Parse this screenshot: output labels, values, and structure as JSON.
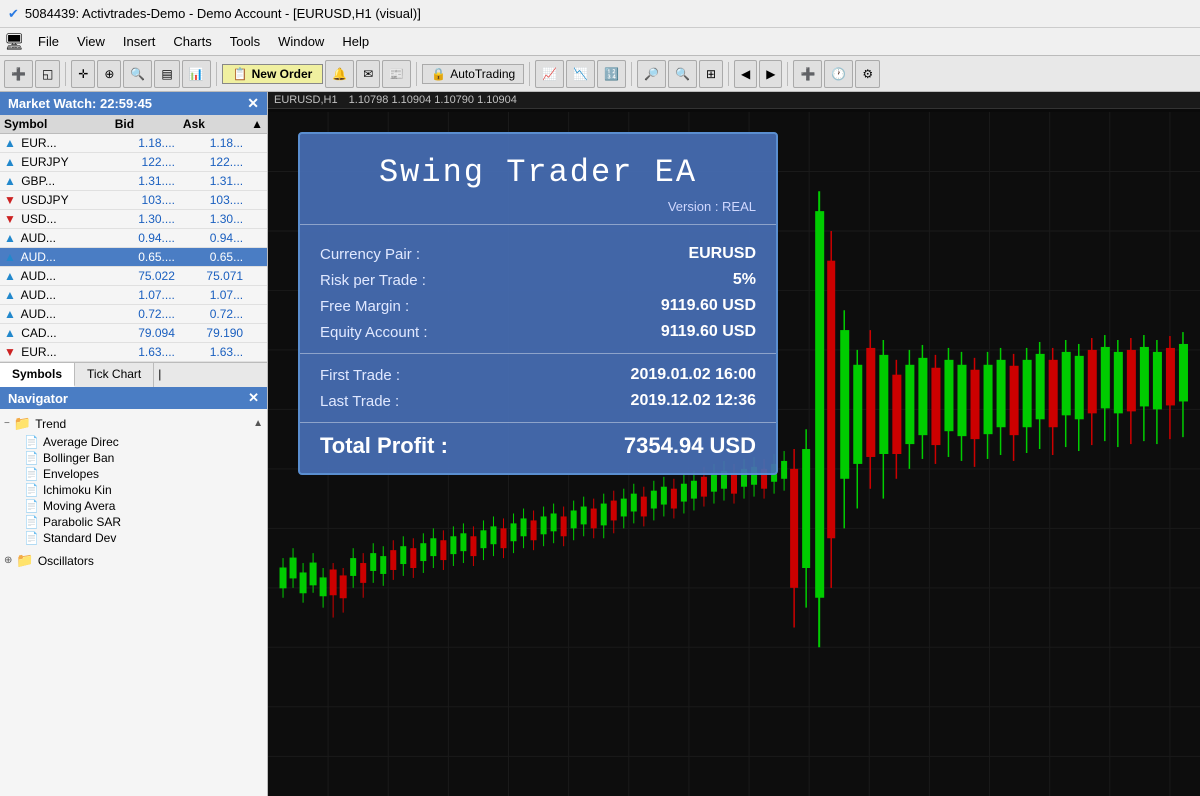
{
  "titleBar": {
    "icon": "✔",
    "text": "5084439: Activtrades-Demo - Demo Account - [EURUSD,H1 (visual)]"
  },
  "menuBar": {
    "items": [
      "File",
      "View",
      "Insert",
      "Charts",
      "Tools",
      "Window",
      "Help"
    ]
  },
  "toolbar": {
    "newOrderLabel": "New Order",
    "autoTradingLabel": "AutoTrading"
  },
  "marketWatch": {
    "title": "Market Watch:",
    "time": "22:59:45",
    "columns": [
      "Symbol",
      "Bid",
      "Ask"
    ],
    "rows": [
      {
        "symbol": "EUR...",
        "bid": "1.18....",
        "ask": "1.18...",
        "dir": "up"
      },
      {
        "symbol": "EURJPY",
        "bid": "122....",
        "ask": "122....",
        "dir": "up"
      },
      {
        "symbol": "GBP...",
        "bid": "1.31....",
        "ask": "1.31...",
        "dir": "up"
      },
      {
        "symbol": "USDJPY",
        "bid": "103....",
        "ask": "103....",
        "dir": "down"
      },
      {
        "symbol": "USD...",
        "bid": "1.30....",
        "ask": "1.30...",
        "dir": "down"
      },
      {
        "symbol": "AUD...",
        "bid": "0.94....",
        "ask": "0.94...",
        "dir": "up"
      },
      {
        "symbol": "AUD...",
        "bid": "0.65....",
        "ask": "0.65...",
        "dir": "up",
        "selected": true
      },
      {
        "symbol": "AUD...",
        "bid": "75.022",
        "ask": "75.071",
        "dir": "up"
      },
      {
        "symbol": "AUD...",
        "bid": "1.07....",
        "ask": "1.07...",
        "dir": "up"
      },
      {
        "symbol": "AUD...",
        "bid": "0.72....",
        "ask": "0.72...",
        "dir": "up"
      },
      {
        "symbol": "CAD...",
        "bid": "79.094",
        "ask": "79.190",
        "dir": "up"
      },
      {
        "symbol": "EUR...",
        "bid": "1.63....",
        "ask": "1.63...",
        "dir": "down"
      }
    ],
    "tabs": [
      "Symbols",
      "Tick Chart",
      "|"
    ]
  },
  "navigator": {
    "title": "Navigator",
    "trendLabel": "Trend",
    "indicators": [
      "Average Direc",
      "Bollinger Ban",
      "Envelopes",
      "Ichimoku Kin",
      "Moving Avera",
      "Parabolic SAR",
      "Standard Dev"
    ],
    "oscillatorsLabel": "Oscillators"
  },
  "chartHeader": {
    "symbol": "EURUSD,H1",
    "prices": "1.10798 1.10904 1.10790 1.10904"
  },
  "overlay": {
    "title": "Swing Trader EA",
    "version": "Version : REAL",
    "currencyPairLabel": "Currency Pair :",
    "currencyPairValue": "EURUSD",
    "riskLabel": "Risk per Trade :",
    "riskValue": "5%",
    "freeMarginLabel": "Free Margin :",
    "freeMarginValue": "9119.60 USD",
    "equityLabel": "Equity Account :",
    "equityValue": "9119.60 USD",
    "firstTradeLabel": "First Trade :",
    "firstTradeValue": "2019.01.02 16:00",
    "lastTradeLabel": "Last Trade :",
    "lastTradeValue": "2019.12.02 12:36",
    "totalProfitLabel": "Total Profit :",
    "totalProfitValue": "7354.94 USD"
  }
}
